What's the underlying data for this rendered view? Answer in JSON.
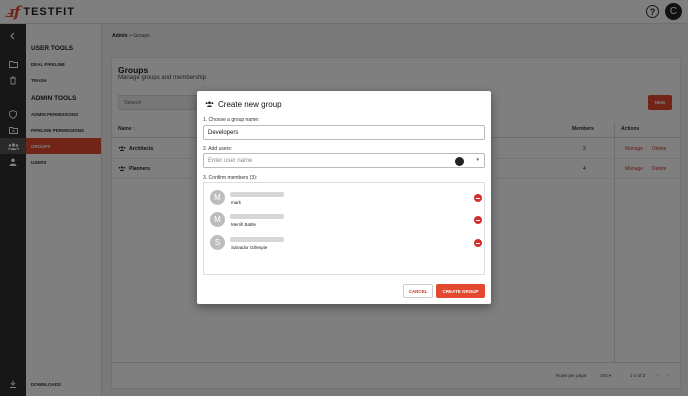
{
  "app": {
    "logo_mark": "ⅎf",
    "logo_text": "TESTFIT",
    "help_symbol": "?",
    "user_initial": "C"
  },
  "rail_icons": [
    "chevron-left-icon",
    "folder-icon",
    "trash-icon",
    "shield-icon",
    "folder-open-icon",
    "groups-icon",
    "user-icon",
    "download-icon"
  ],
  "sidebar": {
    "user_tools_heading": "USER TOOLS",
    "deal_pipeline": "DEAL PIPELINE",
    "trash": "TRASH",
    "admin_tools_heading": "ADMIN TOOLS",
    "admin_permissions": "ADMIN PERMISSIONS",
    "pipeline_permissions": "PIPELINE PERMISSIONS",
    "groups": "GROUPS",
    "users": "USERS",
    "downloads": "DOWNLOADS"
  },
  "breadcrumb": {
    "root": "Admin",
    "separator": ">",
    "current": "Groups"
  },
  "page": {
    "title": "Groups",
    "subtitle": "Manage groups and membership",
    "search_placeholder": "Search",
    "new_button": "NEW"
  },
  "table": {
    "col_name": "Name ↑",
    "col_members": "Members",
    "col_actions": "Actions",
    "rows": [
      {
        "name": "Architects",
        "members": "2",
        "manage": "Manage",
        "delete": "Delete"
      },
      {
        "name": "Planners",
        "members": "4",
        "manage": "Manage",
        "delete": "Delete"
      }
    ],
    "rows_per_page_label": "Rows per page:",
    "rows_per_page_value": "100 ▾",
    "range": "1-2 of 2",
    "prev": "‹",
    "next": "›"
  },
  "modal": {
    "title": "Create new group",
    "step1_label": "1. Choose a group name:",
    "group_name_value": "Developers",
    "step2_label": "2. Add users:",
    "add_users_placeholder": "Enter user name",
    "dropdown_caret": "▾",
    "step3_label": "3. Confirm members (3):",
    "members": [
      {
        "initial": "M",
        "name": "mark"
      },
      {
        "initial": "M",
        "name": "Merrill Battle"
      },
      {
        "initial": "S",
        "name": "Salvador Gillespie"
      }
    ],
    "cancel_button": "CANCEL",
    "create_button": "CREATE GROUP"
  },
  "colors": {
    "accent": "#e2492f",
    "rail": "#2f2f2f",
    "remove": "#d32f2f"
  }
}
